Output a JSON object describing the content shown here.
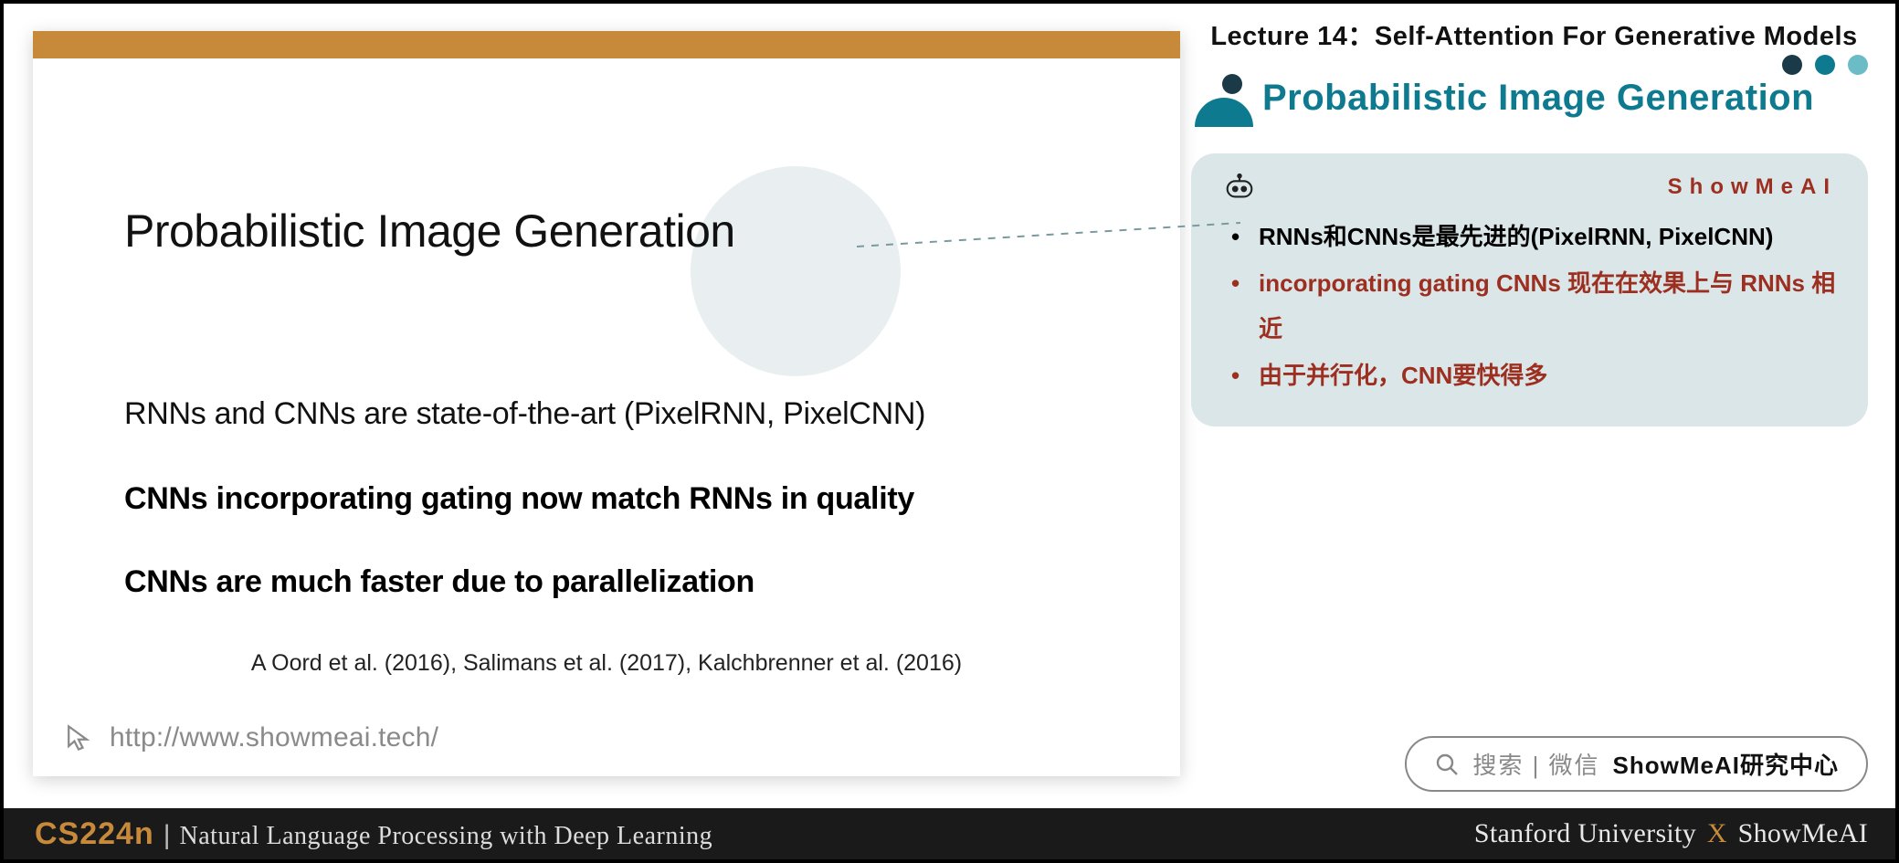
{
  "lecture_header": "Lecture 14：Self-Attention For Generative Models",
  "section_title": "Probabilistic Image Generation",
  "slide": {
    "title": "Probabilistic Image Generation",
    "line1": "RNNs and CNNs are state-of-the-art (PixelRNN, PixelCNN)",
    "line2": "CNNs incorporating gating now match RNNs in quality",
    "line3": "CNNs are much faster due to parallelization",
    "refs": "A Oord et al. (2016),  Salimans et al. (2017), Kalchbrenner et al. (2016)",
    "url": "http://www.showmeai.tech/"
  },
  "note": {
    "brand": "ShowMeAI",
    "items": [
      {
        "text": "RNNs和CNNs是最先进的(PixelRNN, PixelCNN)",
        "color": "black"
      },
      {
        "text": "incorporating gating CNNs 现在在效果上与 RNNs 相近",
        "color": "red"
      },
      {
        "text": "由于并行化，CNN要快得多",
        "color": "red"
      }
    ]
  },
  "search": {
    "prefix": "搜索 | 微信",
    "name": "ShowMeAI研究中心"
  },
  "footer": {
    "course_code": "CS224n",
    "course_name": "Natural Language Processing with Deep Learning",
    "uni": "Stanford University",
    "partner": "ShowMeAI"
  }
}
